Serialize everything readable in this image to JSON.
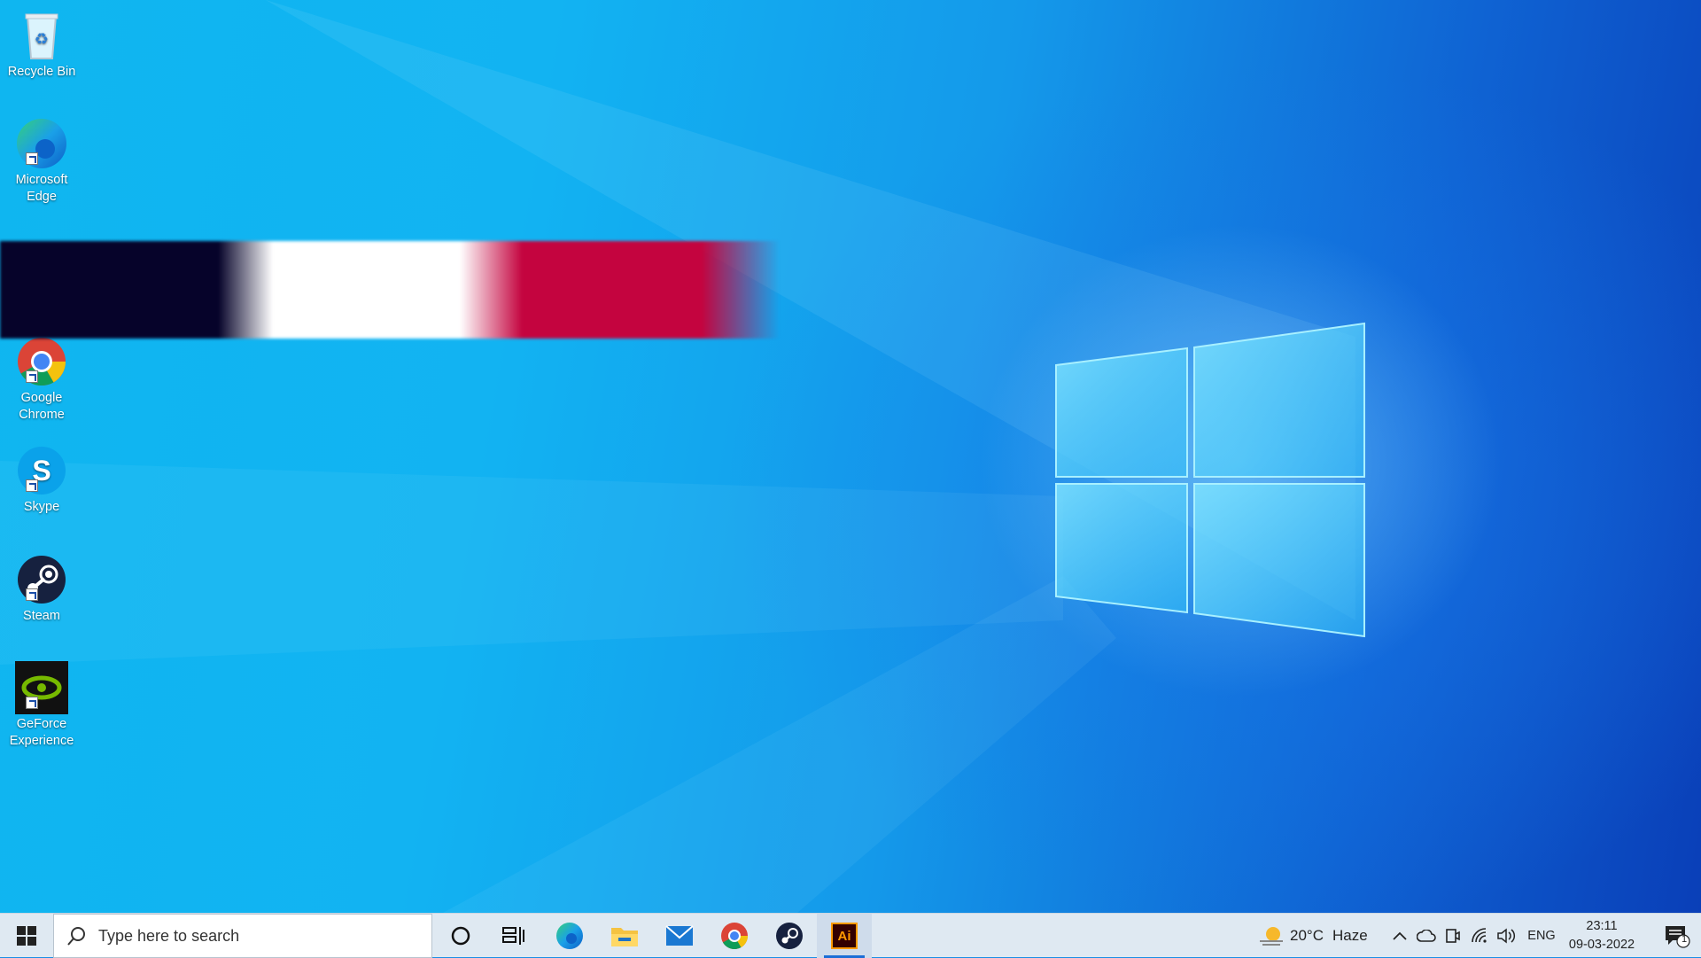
{
  "desktop": {
    "icons": [
      {
        "label": "Recycle Bin",
        "icon": "recycle-bin-icon"
      },
      {
        "label": "Microsoft Edge",
        "icon": "edge-icon"
      },
      {
        "label": "Google Chrome",
        "icon": "chrome-icon"
      },
      {
        "label": "Skype",
        "icon": "skype-icon"
      },
      {
        "label": "Steam",
        "icon": "steam-icon"
      },
      {
        "label": "GeForce Experience",
        "icon": "geforce-icon"
      }
    ]
  },
  "taskbar": {
    "search_placeholder": "Type here to search",
    "pinned": [
      "cortana-icon",
      "task-view-icon",
      "edge-icon",
      "file-explorer-icon",
      "mail-icon",
      "chrome-icon",
      "steam-icon",
      "illustrator-icon"
    ],
    "illustrator_label": "Ai",
    "active_app": "illustrator",
    "weather": {
      "temp": "20°C",
      "condition": "Haze"
    },
    "language": "ENG",
    "time": "23:11",
    "date": "09-03-2022",
    "notification_count": "1"
  },
  "colors": {
    "accent": "#1b6ed6",
    "glitch": [
      "#06032a",
      "#ffffff",
      "#c4043f"
    ]
  }
}
